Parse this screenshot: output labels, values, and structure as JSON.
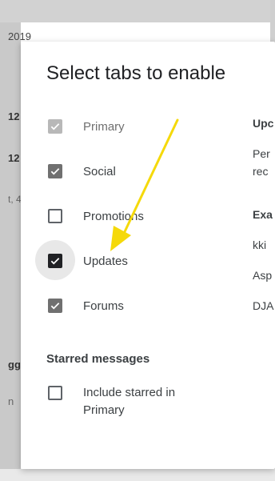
{
  "background": {
    "year_fragment": "2019",
    "row_fragments": [
      "12",
      "12",
      "t, 4",
      "gg",
      "n"
    ]
  },
  "dialog": {
    "title": "Select tabs to enable",
    "options": [
      {
        "label": "Primary",
        "state": "checked-disabled"
      },
      {
        "label": "Social",
        "state": "checked"
      },
      {
        "label": "Promotions",
        "state": "unchecked"
      },
      {
        "label": "Updates",
        "state": "checked-focused"
      },
      {
        "label": "Forums",
        "state": "checked"
      }
    ],
    "starred_section": {
      "heading": "Starred messages",
      "option_label": "Include starred in Primary",
      "state": "unchecked"
    },
    "right_column": {
      "heading": "Upc",
      "description_line1": "Per",
      "description_line2": "rec",
      "examples_heading": "Exa",
      "examples": [
        "kki",
        "Asp",
        "DJA"
      ]
    }
  },
  "annotation": {
    "arrow_color": "#f5d90a",
    "points_to": "Updates"
  },
  "colors": {
    "checkbox_dark": "#202124",
    "checkbox_gray": "#707070",
    "checkbox_disabled": "#b8b8b8",
    "text": "#3c4043"
  }
}
